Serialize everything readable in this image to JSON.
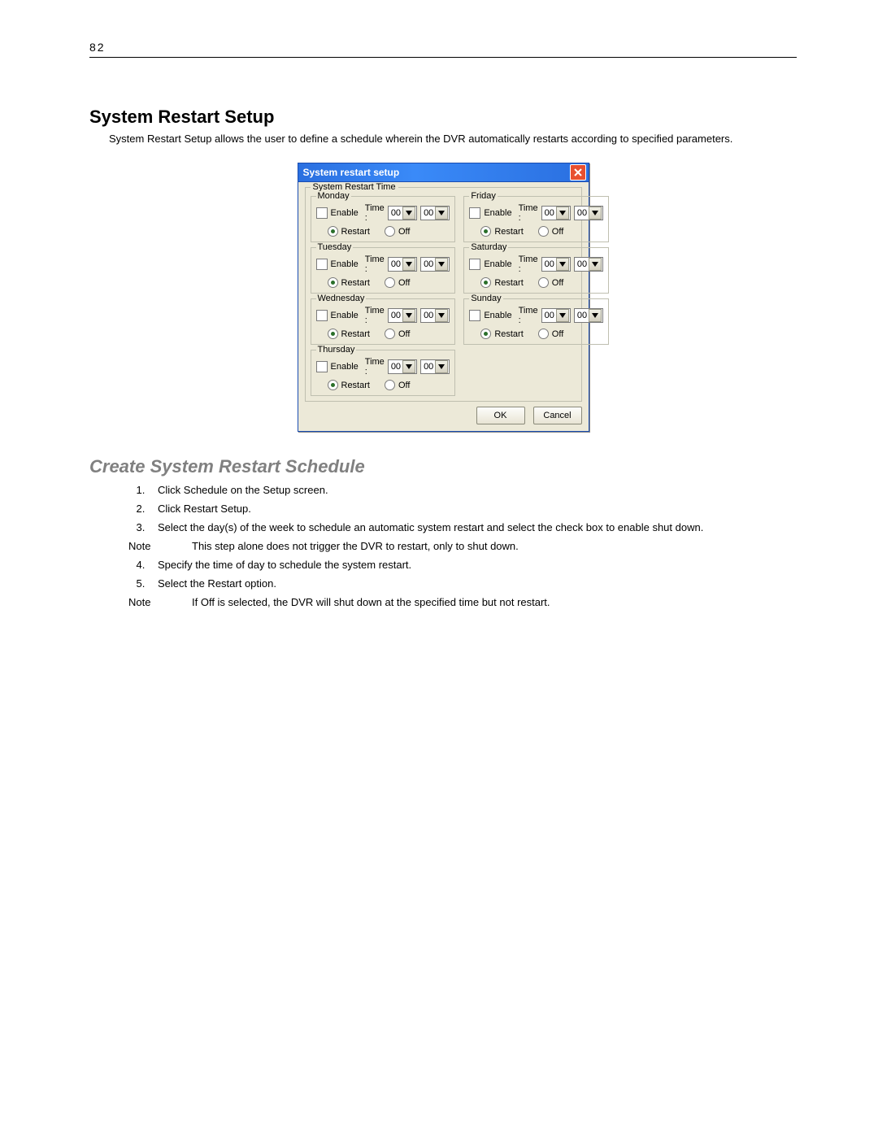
{
  "page_number": "82",
  "section_title": "System Restart Setup",
  "intro_text": "System Restart Setup allows the user to define a schedule wherein the DVR automatically restarts according to specified parameters.",
  "dialog": {
    "title": "System restart setup",
    "group_label": "System Restart Time",
    "enable_label": "Enable",
    "time_label": "Time :",
    "restart_label": "Restart",
    "off_label": "Off",
    "hour_value": "00",
    "minute_value": "00",
    "ok_label": "OK",
    "cancel_label": "Cancel",
    "days": {
      "c0r0": "Monday",
      "c1r0": "Friday",
      "c0r1": "Tuesday",
      "c1r1": "Saturday",
      "c0r2": "Wednesday",
      "c1r2": "Sunday",
      "c0r3": "Thursday"
    }
  },
  "sub_title": "Create System Restart Schedule",
  "steps": {
    "s1": "Click Schedule on the Setup screen.",
    "s2": "Click Restart Setup.",
    "s3": "Select the day(s) of the week to schedule an automatic system restart and select the check box to enable shut down.",
    "s4": "Specify the time of day to schedule the system restart.",
    "s5": "Select the Restart option."
  },
  "notes": {
    "label": "Note",
    "n1": "This step alone does not trigger the DVR to restart, only to shut down.",
    "n2": "If Off is selected, the DVR will shut down at the specified time but not restart."
  }
}
